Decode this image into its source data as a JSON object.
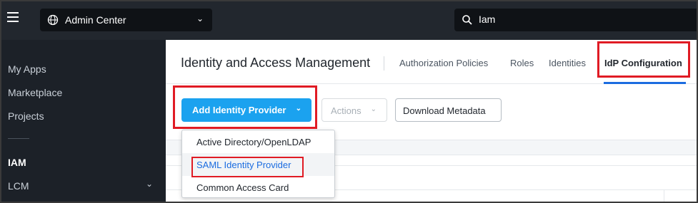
{
  "topbar": {
    "menu_icon": "hamburger-icon",
    "app_switcher": {
      "icon": "globe-icon",
      "label": "Admin Center",
      "chevron": "chevron-down-icon"
    },
    "search": {
      "icon": "search-icon",
      "value": "Iam",
      "placeholder": ""
    }
  },
  "sidebar": {
    "items": [
      {
        "label": "My Apps"
      },
      {
        "label": "Marketplace"
      },
      {
        "label": "Projects"
      },
      {
        "label": "IAM",
        "active": true
      },
      {
        "label": "LCM",
        "has_chevron": true
      }
    ]
  },
  "main": {
    "page_title": "Identity and Access Management",
    "tabs": [
      {
        "label": "Authorization Policies"
      },
      {
        "label": "Roles"
      },
      {
        "label": "Identities"
      },
      {
        "label": "IdP Configuration",
        "active": true
      }
    ],
    "toolbar": {
      "add_idp_label": "Add Identity Provider",
      "actions_label": "Actions",
      "download_label": "Download Metadata"
    },
    "dropdown": {
      "items": [
        {
          "label": "Active Directory/OpenLDAP"
        },
        {
          "label": "SAML Identity Provider",
          "selected": true
        },
        {
          "label": "Common Access Card"
        }
      ]
    }
  },
  "colors": {
    "topbar_bg": "#22272e",
    "sidebar_bg": "#1c2128",
    "primary_button": "#1ba2ef",
    "active_tab_underline": "#1b6ce0",
    "highlight_box": "#e01b24"
  }
}
